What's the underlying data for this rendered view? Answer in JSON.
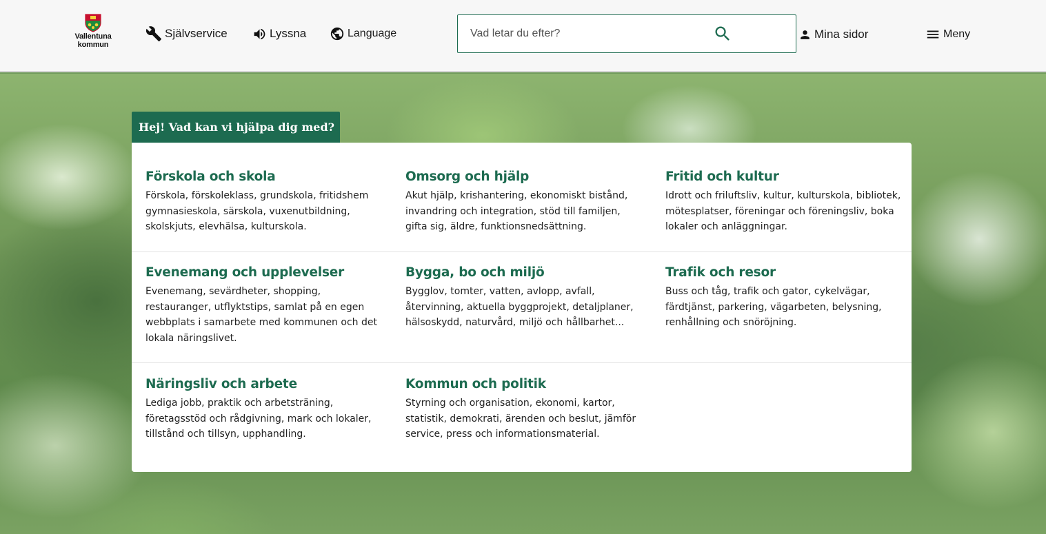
{
  "header": {
    "logo_text": [
      "Vallentuna",
      "kommun"
    ],
    "links": {
      "selfservice": "Självservice",
      "listen": "Lyssna",
      "language": "Language",
      "my_pages": "Mina sidor",
      "menu": "Meny"
    },
    "search": {
      "placeholder": "Vad letar du efter?",
      "value": ""
    },
    "icons": {
      "selfservice": "wrench-icon",
      "listen": "speaker-icon",
      "language": "globe-icon",
      "search": "search-icon",
      "my_pages": "person-icon",
      "menu": "hamburger-icon"
    }
  },
  "help": {
    "tab_label": "Hej! Vad kan vi hjälpa dig med?"
  },
  "categories": [
    {
      "title": "Förskola och skola",
      "description": "Förskola, förskoleklass, grundskola, fritidshem gymnasieskola, särskola, vuxenutbildning, skolskjuts, elevhälsa, kulturskola."
    },
    {
      "title": "Omsorg och hjälp",
      "description": "Akut hjälp, krishantering, ekonomiskt bistånd, invandring och integration, stöd till familjen, gifta sig, äldre, funktionsnedsättning."
    },
    {
      "title": "Fritid och kultur",
      "description": "Idrott och friluftsliv, kultur, kulturskola, bibliotek, mötesplatser, föreningar och föreningsliv, boka lokaler och anläggningar."
    },
    {
      "title": "Evenemang och upplevelser",
      "description": "Evenemang, sevärdheter, shopping, restauranger, utflyktstips, samlat på en egen webbplats i samarbete med kommunen och det lokala näringslivet."
    },
    {
      "title": "Bygga, bo och miljö",
      "description": "Bygglov, tomter, vatten, avlopp, avfall, återvinning, aktuella byggprojekt, detaljplaner, hälsoskydd, naturvård, miljö och hållbarhet..."
    },
    {
      "title": "Trafik och resor",
      "description": "Buss och tåg, trafik och gator, cykelvägar, färdtjänst, parkering, vägarbeten, belysning, renhållning och snöröjning."
    },
    {
      "title": "Näringsliv och arbete",
      "description": "Lediga jobb, praktik och arbetsträning, företagsstöd och rådgivning, mark och lokaler, tillstånd och tillsyn, upphandling."
    },
    {
      "title": "Kommun och politik",
      "description": "Styrning och organisation, ekonomi, kartor, statistik, demokrati, ärenden och beslut, jämför service, press och informationsmaterial."
    }
  ],
  "colors": {
    "brand_green": "#1d6b50",
    "header_bg": "#f7f7f7",
    "card_bg": "#ffffff"
  }
}
